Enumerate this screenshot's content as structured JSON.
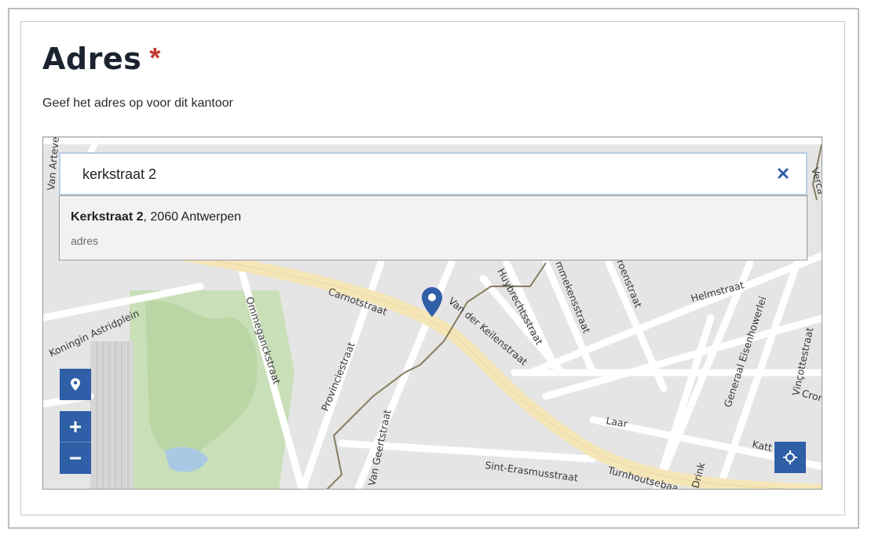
{
  "header": {
    "title": "Adres",
    "required_mark": "*",
    "description": "Geef het adres op voor dit kantoor"
  },
  "search": {
    "value": "kerkstraat 2",
    "clear_icon": "close-icon"
  },
  "suggestion": {
    "street": "Kerkstraat 2",
    "rest": ", 2060 Antwerpen",
    "type": "adres"
  },
  "controls": {
    "locate_icon": "location-pin-icon",
    "zoom_in": "+",
    "zoom_out": "−",
    "crosshair_icon": "crosshair-icon"
  },
  "colors": {
    "accent_blue": "#2f5fa7",
    "required_red": "#c0392b",
    "map_background": "#e5e5e5",
    "road_major": "#f5e6b8",
    "park_green": "#c8dfb8"
  },
  "map": {
    "streets": {
      "carnotstraat": "Carnotstraat",
      "van_der_keilenstraat": "Van der Keilenstraat",
      "huybrechtsstraat": "Huybrechtsstraat",
      "mmekensstraat": "mmekensstraat",
      "roenstraat": "roenstraat",
      "helmstraat": "Helmstraat",
      "koningin_astridplein": "Koningin Astridplein",
      "ommeganckstraat": "Ommeganckstraat",
      "provinciestraat": "Provinciestraat",
      "van_geertstraat": "Van Geertstraat",
      "sint_erasmusstraat": "Sint-Erasmusstraat",
      "turnhoutsebaan": "Turnhoutsebaa",
      "laar": "Laar",
      "drink": "Drink",
      "generaal_eisenhowerlei": "Generaal Eisenhowerlei",
      "vinckotestraat": "Vinçottestraat",
      "cron": "Cron",
      "katt": "Katt",
      "van_arteve": "Van Arteve",
      "verca": "Verca"
    }
  }
}
